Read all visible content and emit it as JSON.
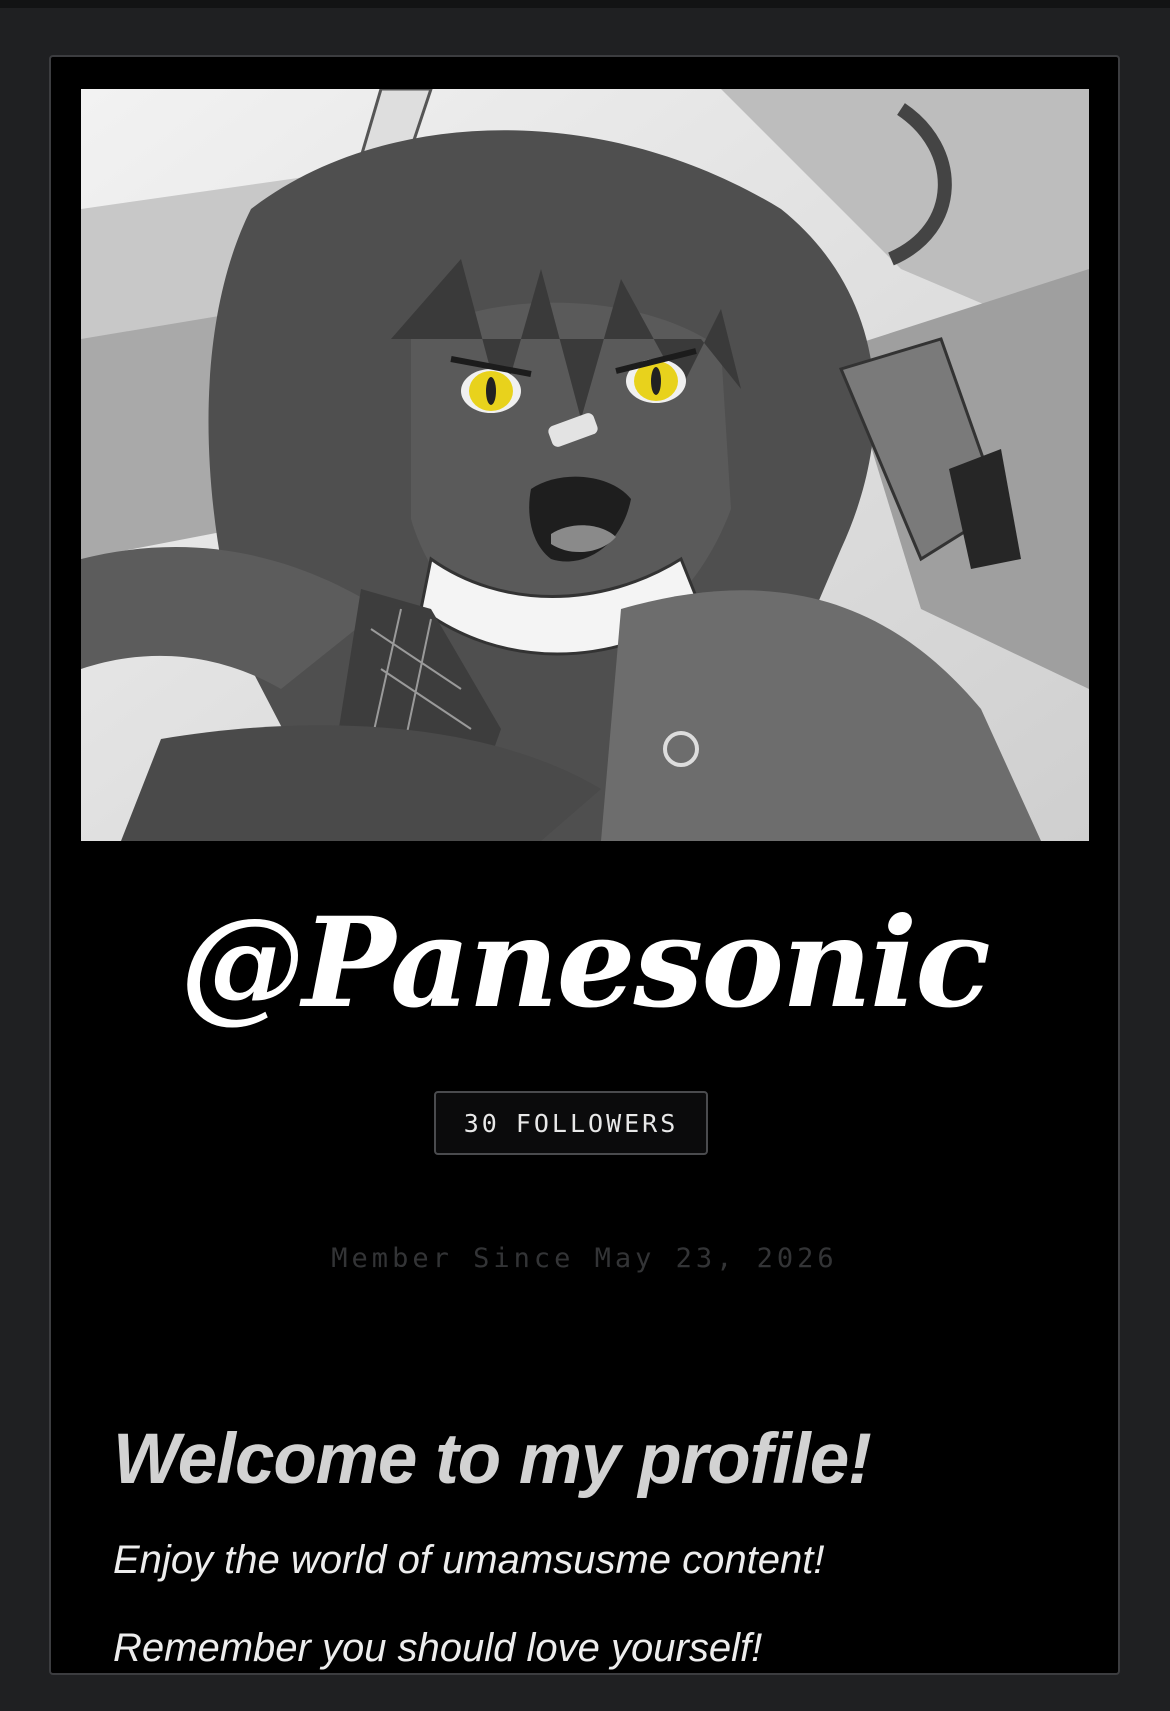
{
  "profile": {
    "username": "@Panesonic",
    "followers_count": "30",
    "followers_label": "FOLLOWERS",
    "member_since": "Member Since May 23, 2026",
    "banner_image": "grayscale anime character illustration with yellow eyes"
  },
  "bio": {
    "heading": "Welcome to my profile!",
    "lines": [
      "Enjoy the world of umamsusme content!",
      "Remember you should love yourself!"
    ]
  },
  "colors": {
    "page_background": "#1f2022",
    "card_background": "#000000",
    "card_border": "#3c3d40",
    "username_text": "#ffffff",
    "badge_border": "#4a4b4e",
    "member_since_text": "#333436",
    "eye_accent": "#e8d21c"
  }
}
